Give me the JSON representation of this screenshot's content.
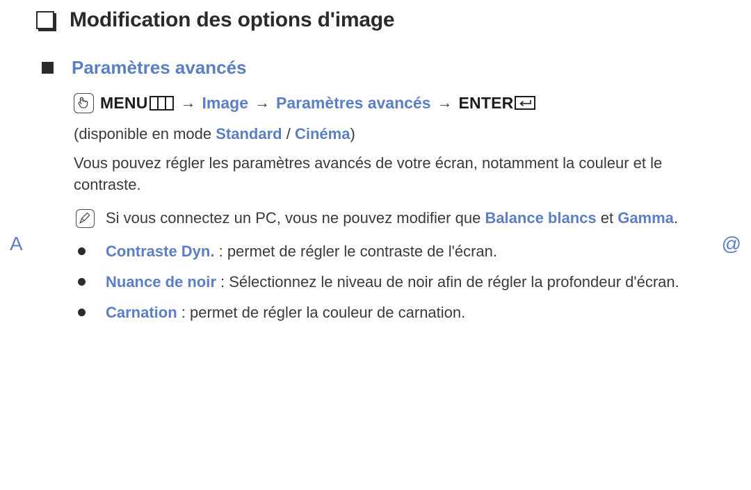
{
  "page": {
    "title": "Modification des options d'image",
    "section_heading": "Paramètres avancés"
  },
  "edge_markers": {
    "left": "A",
    "right": "@",
    "color": "#5b7fc4"
  },
  "menu_path": {
    "oo_icon": "touch-hand-icon",
    "menu_label": "MENU",
    "menu_icon": "menu-bars-icon",
    "arrow1": "→",
    "step_image": "Image",
    "arrow2": "→",
    "step_advanced": "Paramètres avancés",
    "arrow3": "→",
    "enter_label": "ENTER",
    "enter_icon": "enter-return-icon"
  },
  "availability": {
    "prefix": "(disponible en mode ",
    "mode1": "Standard",
    "separator": " / ",
    "mode2": "Cinéma",
    "suffix": ")"
  },
  "intro_paragraph": "Vous pouvez régler les paramètres avancés de votre écran, notamment la couleur et le contraste.",
  "note": {
    "icon": "note-pencil-icon",
    "text_before": "Si vous connectez un PC, vous ne pouvez modifier que ",
    "highlight1": "Balance blancs",
    "text_middle": " et ",
    "highlight2": "Gamma",
    "text_after": "."
  },
  "bullets": [
    {
      "term": "Contraste Dyn.",
      "description": " : permet de régler le contraste de l'écran."
    },
    {
      "term": "Nuance de noir",
      "description": " : Sélectionnez le niveau de noir afin de régler la profondeur d'écran."
    },
    {
      "term": "Carnation",
      "description": " : permet de régler la couleur de carnation."
    }
  ],
  "colors": {
    "accent_blue": "#5b7fc4",
    "body_text": "#3a3a3a",
    "heading_text": "#2b2b2b",
    "background": "#ffffff"
  }
}
